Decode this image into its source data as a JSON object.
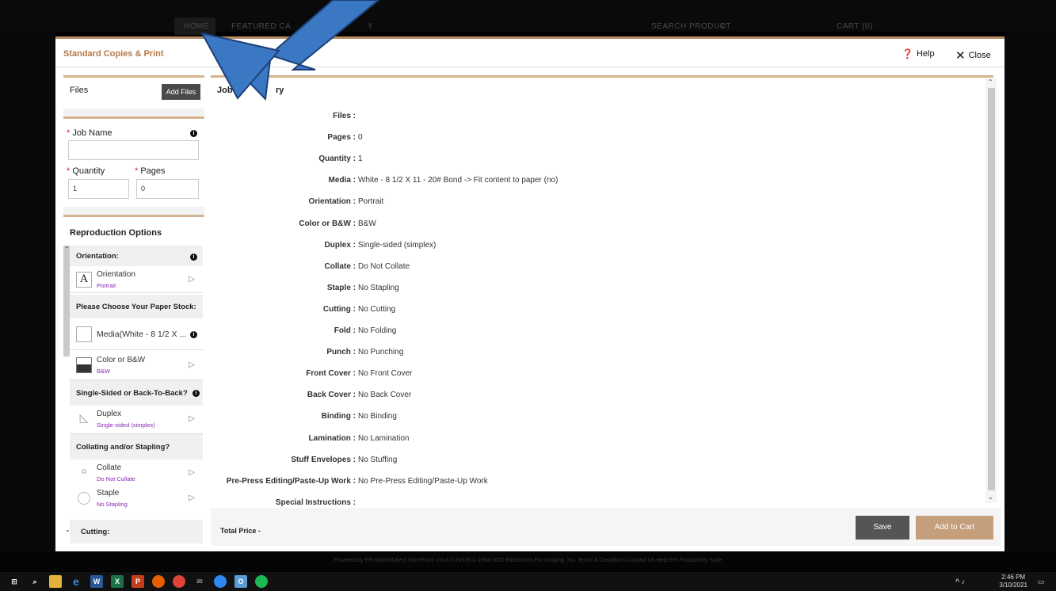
{
  "site_nav": {
    "home": "HOME",
    "featured": "FEATURED CA",
    "y_suffix": "Y",
    "search": "SEARCH PRODUCT",
    "cart": "CART (0)"
  },
  "modal": {
    "title": "Standard Copies & Print",
    "help": "Help",
    "close": "Close"
  },
  "files": {
    "label": "Files",
    "add_button": "Add Files"
  },
  "job": {
    "name_label": "Job Name",
    "name_value": "",
    "quantity_label": "Quantity",
    "quantity_value": "1",
    "pages_label": "Pages",
    "pages_value": "0"
  },
  "repro": {
    "title": "Reproduction Options",
    "orientation_head": "Orientation:",
    "orientation": {
      "label": "Orientation",
      "sub": "Portrait",
      "icon": "A"
    },
    "paper_head": "Please Choose Your Paper Stock:",
    "media": {
      "label": "Media(White - 8 1/2 X ..."
    },
    "color": {
      "label": "Color or B&W",
      "sub": "B&W"
    },
    "sided_head": "Single-Sided or Back-To-Back?",
    "duplex": {
      "label": "Duplex",
      "sub": "Single-sided (simplex)"
    },
    "collate_head": "Collating and/or Stapling?",
    "collate": {
      "label": "Collate",
      "sub": "Do Not Collate"
    },
    "staple": {
      "label": "Staple",
      "sub": "No Stapling"
    },
    "cutting_head": "Cutting:"
  },
  "summary": {
    "title": "Job S",
    "title_tail": "ry",
    "rows": [
      {
        "label": "Files :",
        "value": ""
      },
      {
        "label": "Pages :",
        "value": "0"
      },
      {
        "label": "Quantity :",
        "value": "1"
      },
      {
        "label": "Media :",
        "value": "White - 8 1/2 X 11 - 20# Bond -> Fit content to paper (no)"
      },
      {
        "label": "Orientation :",
        "value": "Portrait"
      },
      {
        "label": "Color or B&W :",
        "value": "B&W"
      },
      {
        "label": "Duplex :",
        "value": "Single-sided (simplex)"
      },
      {
        "label": "Collate :",
        "value": "Do Not Collate"
      },
      {
        "label": "Staple :",
        "value": "No Stapling"
      },
      {
        "label": "Cutting :",
        "value": "No Cutting"
      },
      {
        "label": "Fold :",
        "value": "No Folding"
      },
      {
        "label": "Punch :",
        "value": "No Punching"
      },
      {
        "label": "Front Cover :",
        "value": "No Front Cover"
      },
      {
        "label": "Back Cover :",
        "value": "No Back Cover"
      },
      {
        "label": "Binding :",
        "value": "No Binding"
      },
      {
        "label": "Lamination :",
        "value": "No Lamination"
      },
      {
        "label": "Stuff Envelopes :",
        "value": "No Stuffing"
      },
      {
        "label": "Pre-Press Editing/Paste-Up Work :",
        "value": "No Pre-Press Editing/Paste-Up Work"
      },
      {
        "label": "Special Instructions :",
        "value": ""
      }
    ]
  },
  "footer": {
    "total_price": "Total Price -",
    "save": "Save",
    "add_to_cart": "Add to Cart"
  },
  "site_footer": "Powered by EFI MarketDirect StoreFront  v10.6.0.24335  © 2004-2020 Electronics For Imaging, Inc.  Terms & Conditions  Contact Us  Help  EFI Productivity Suite",
  "taskbar": {
    "time": "2:46 PM",
    "date": "3/10/2021"
  },
  "colors": {
    "accent": "#b47a48",
    "cart": "#c59e7b",
    "arrow": "#3a78c4",
    "sub": "#8a2ab3"
  }
}
